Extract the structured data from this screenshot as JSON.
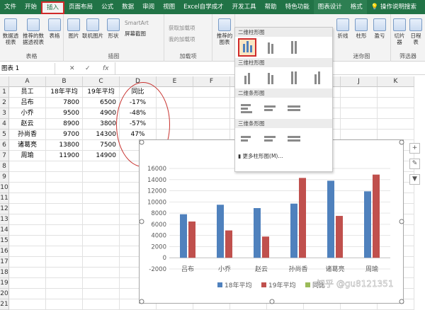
{
  "ribbon_tabs": [
    "文件",
    "开始",
    "插入",
    "页面布局",
    "公式",
    "数据",
    "审阅",
    "视图",
    "Excel自学成才",
    "开发工具",
    "帮助",
    "特色功能",
    "图表设计",
    "格式",
    "操作说明搜索"
  ],
  "ribbon": {
    "groups": [
      "表格",
      "插图",
      "加载项",
      "迷你图",
      "筛选器"
    ],
    "buttons": {
      "pivot": "数据透视表",
      "rec_pivot": "推荐的数据透视表",
      "table": "表格",
      "picture": "图片",
      "online_picture": "联机图片",
      "shapes": "形状",
      "smartart": "SmartArt",
      "screenshot": "屏幕截图",
      "get_addins": "获取加载项",
      "my_addins": "我的加载项",
      "rec_charts": "推荐的图表",
      "line": "折线",
      "column": "柱形",
      "winloss": "盈亏",
      "slicer": "切片器",
      "timeline": "日程表"
    }
  },
  "formula_bar": {
    "name_box": "图表 1",
    "fx": "fx"
  },
  "columns": [
    "A",
    "B",
    "C",
    "D",
    "E",
    "F",
    "G",
    "H",
    "I",
    "J",
    "K"
  ],
  "rows": [
    "1",
    "2",
    "3",
    "4",
    "5",
    "6",
    "7",
    "8",
    "9",
    "10",
    "11",
    "12",
    "13",
    "14",
    "15",
    "16",
    "17",
    "18",
    "19",
    "20",
    "21"
  ],
  "table": {
    "headers": [
      "员工",
      "18年平均",
      "19年平均",
      "同比"
    ],
    "rows": [
      [
        "吕布",
        "7800",
        "6500",
        "-17%"
      ],
      [
        "小乔",
        "9500",
        "4900",
        "-48%"
      ],
      [
        "赵云",
        "8900",
        "3800",
        "-57%"
      ],
      [
        "孙尚香",
        "9700",
        "14300",
        "47%"
      ],
      [
        "诸葛亮",
        "13800",
        "7500",
        ""
      ],
      [
        "周瑜",
        "11900",
        "14900",
        ""
      ]
    ]
  },
  "gallery": {
    "sections": [
      "二维柱形图",
      "三维柱形图",
      "二维条形图",
      "三维条形图"
    ],
    "more": "更多柱形图(M)..."
  },
  "chart_data": {
    "type": "bar",
    "categories": [
      "吕布",
      "小乔",
      "赵云",
      "孙尚香",
      "诸葛亮",
      "周瑜"
    ],
    "series": [
      {
        "name": "18年平均",
        "values": [
          7800,
          9500,
          8900,
          9700,
          13800,
          11900
        ],
        "color": "#4f81bd"
      },
      {
        "name": "19年平均",
        "values": [
          6500,
          4900,
          3800,
          14300,
          7500,
          14900
        ],
        "color": "#c0504d"
      },
      {
        "name": "同比",
        "values": [
          -0.17,
          -0.48,
          -0.57,
          0.47,
          0,
          0
        ],
        "color": "#9bbb59"
      }
    ],
    "ylim": [
      -2000,
      16000
    ],
    "yticks": [
      "16000",
      "14000",
      "12000",
      "10000",
      "8000",
      "6000",
      "4000",
      "2000",
      "0",
      "-2000"
    ],
    "legend_position": "bottom"
  },
  "watermark": "知乎 @gu8121351",
  "chart_side_buttons": [
    "+",
    "✎",
    "▼"
  ]
}
